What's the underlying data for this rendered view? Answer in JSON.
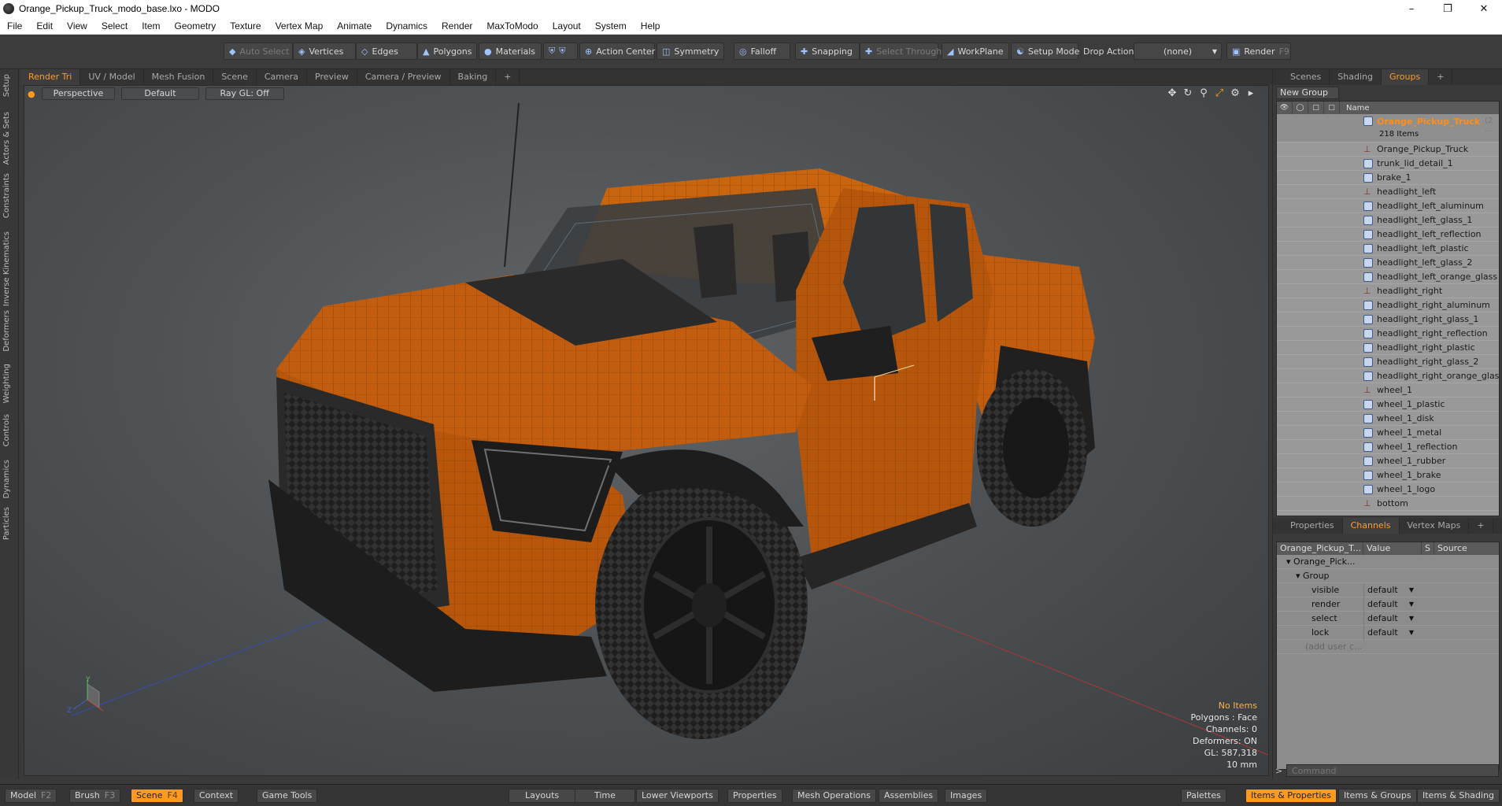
{
  "title": "Orange_Pickup_Truck_modo_base.lxo - MODO",
  "window_controls": {
    "min": "–",
    "max": "❐",
    "close": "✕"
  },
  "menu": [
    "File",
    "Edit",
    "View",
    "Select",
    "Item",
    "Geometry",
    "Texture",
    "Vertex Map",
    "Animate",
    "Dynamics",
    "Render",
    "MaxToModo",
    "Layout",
    "System",
    "Help"
  ],
  "toolbar": {
    "auto_select": "Auto Select",
    "vertices": "Vertices",
    "edges": "Edges",
    "polygons": "Polygons",
    "materials": "Materials",
    "action_center": "Action Center",
    "symmetry": "Symmetry",
    "falloff": "Falloff",
    "snapping": "Snapping",
    "select_through": "Select Through",
    "workplane": "WorkPlane",
    "setup_mode": "Setup Mode",
    "drop_action": "Drop Action",
    "drop_value": "(none)",
    "render": "Render",
    "render_key": "F9"
  },
  "left_tabs": [
    "Setup",
    "Actors & Sets",
    "Constraints",
    "Inverse Kinematics",
    "Deformers",
    "Weighting",
    "Controls",
    "Dynamics",
    "Particles"
  ],
  "viewport_tabs": [
    "Render Tri",
    "UV / Model",
    "Mesh Fusion",
    "Scene",
    "Camera",
    "Preview",
    "Camera / Preview",
    "Baking",
    "+"
  ],
  "viewport": {
    "view": "Perspective",
    "shading": "Default",
    "raygl": "Ray GL: Off",
    "stats": {
      "items": "No Items",
      "polygons": "Polygons : Face",
      "channels": "Channels: 0",
      "deformers": "Deformers: ON",
      "gl": "GL: 587,318",
      "unit": "10 mm"
    },
    "axis": {
      "y": "Y",
      "z": "Z"
    }
  },
  "right_top_tabs": [
    "Scenes",
    "Shading",
    "Groups",
    "+"
  ],
  "groups": {
    "new_group": "New Group",
    "name_header": "Name",
    "root": {
      "name": "Orange_Pickup_Truck",
      "suffix": "(2 ...",
      "count": "218 Items"
    },
    "items": [
      {
        "name": "Orange_Pickup_Truck",
        "type": "locator"
      },
      {
        "name": "trunk_lid_detail_1",
        "type": "mesh"
      },
      {
        "name": "brake_1",
        "type": "mesh"
      },
      {
        "name": "headlight_left",
        "type": "locator"
      },
      {
        "name": "headlight_left_aluminum",
        "type": "mesh"
      },
      {
        "name": "headlight_left_glass_1",
        "type": "mesh"
      },
      {
        "name": "headlight_left_reflection",
        "type": "mesh"
      },
      {
        "name": "headlight_left_plastic",
        "type": "mesh"
      },
      {
        "name": "headlight_left_glass_2",
        "type": "mesh"
      },
      {
        "name": "headlight_left_orange_glass",
        "type": "mesh"
      },
      {
        "name": "headlight_right",
        "type": "locator"
      },
      {
        "name": "headlight_right_aluminum",
        "type": "mesh"
      },
      {
        "name": "headlight_right_glass_1",
        "type": "mesh"
      },
      {
        "name": "headlight_right_reflection",
        "type": "mesh"
      },
      {
        "name": "headlight_right_plastic",
        "type": "mesh"
      },
      {
        "name": "headlight_right_glass_2",
        "type": "mesh"
      },
      {
        "name": "headlight_right_orange_glass",
        "type": "mesh"
      },
      {
        "name": "wheel_1",
        "type": "locator"
      },
      {
        "name": "wheel_1_plastic",
        "type": "mesh"
      },
      {
        "name": "wheel_1_disk",
        "type": "mesh"
      },
      {
        "name": "wheel_1_metal",
        "type": "mesh"
      },
      {
        "name": "wheel_1_reflection",
        "type": "mesh"
      },
      {
        "name": "wheel_1_rubber",
        "type": "mesh"
      },
      {
        "name": "wheel_1_brake",
        "type": "mesh"
      },
      {
        "name": "wheel_1_logo",
        "type": "mesh"
      },
      {
        "name": "bottom",
        "type": "locator"
      }
    ]
  },
  "right_bottom_tabs": [
    "Properties",
    "Channels",
    "Vertex Maps",
    "+"
  ],
  "channels": {
    "header": {
      "name": "Orange_Pickup_T...",
      "value": "Value",
      "s": "S",
      "source": "Source"
    },
    "item": "Orange_Pick...",
    "group": "Group",
    "rows": [
      {
        "key": "visible",
        "value": "default"
      },
      {
        "key": "render",
        "value": "default"
      },
      {
        "key": "select",
        "value": "default"
      },
      {
        "key": "lock",
        "value": "default"
      }
    ],
    "add": "(add user c..."
  },
  "command": {
    "prompt": ">",
    "placeholder": "Command"
  },
  "bottom_bar": {
    "model": "Model",
    "model_key": "F2",
    "brush": "Brush",
    "brush_key": "F3",
    "scene": "Scene",
    "scene_key": "F4",
    "context": "Context",
    "game_tools": "Game Tools",
    "layouts": "Layouts",
    "time": "Time",
    "lower_viewports": "Lower Viewports",
    "properties": "Properties",
    "mesh_operations": "Mesh Operations",
    "assemblies": "Assemblies",
    "images": "Images",
    "palettes": "Palettes",
    "items_properties": "Items & Properties",
    "items_groups": "Items & Groups",
    "items_shading": "Items & Shading"
  },
  "colors": {
    "accent": "#ff9a1f",
    "truck_body": "#c25d10",
    "truck_dark": "#2a2a2a"
  }
}
